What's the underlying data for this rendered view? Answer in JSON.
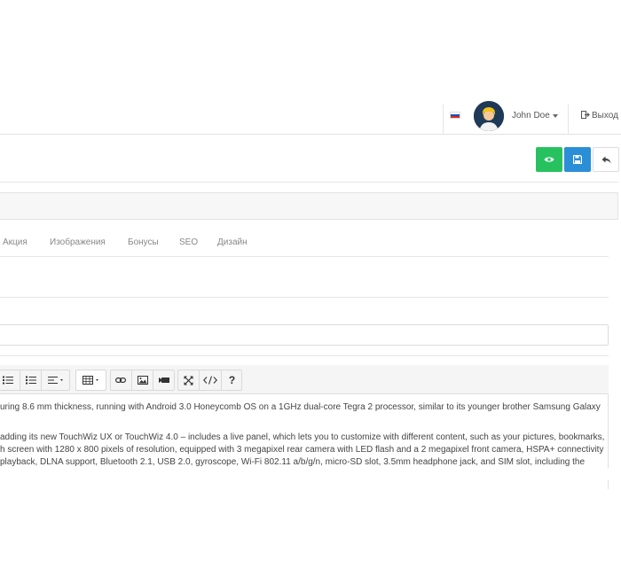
{
  "navbar": {
    "user_name": "John Doe",
    "logout_label": "Выход"
  },
  "tabs": [
    "Акция",
    "Изображения",
    "Бонусы",
    "SEO",
    "Дизайн"
  ],
  "editor": {
    "lines": [
      "uring 8.6 mm thickness, running with Android 3.0 Honeycomb OS on a 1GHz dual-core Tegra 2 processor, similar to its younger brother Samsung Galaxy",
      "",
      "adding its new TouchWiz UX or TouchWiz 4.0 – includes a live panel, which lets you to customize with different content, such as your pictures, bookmarks,",
      "h screen with 1280 x 800 pixels of resolution, equipped with 3 megapixel rear camera with LED flash and a 2 megapixel front camera, HSPA+ connectivity",
      "playback, DLNA support, Bluetooth 2.1, USB 2.0, gyroscope, Wi-Fi 802.11 a/b/g/n, micro-SD slot, 3.5mm headphone jack, and SIM slot, including the"
    ]
  },
  "colors": {
    "preview_button": "#27c25f",
    "save_button": "#2a8fd6",
    "avatar_bg": "#1f3a56"
  }
}
